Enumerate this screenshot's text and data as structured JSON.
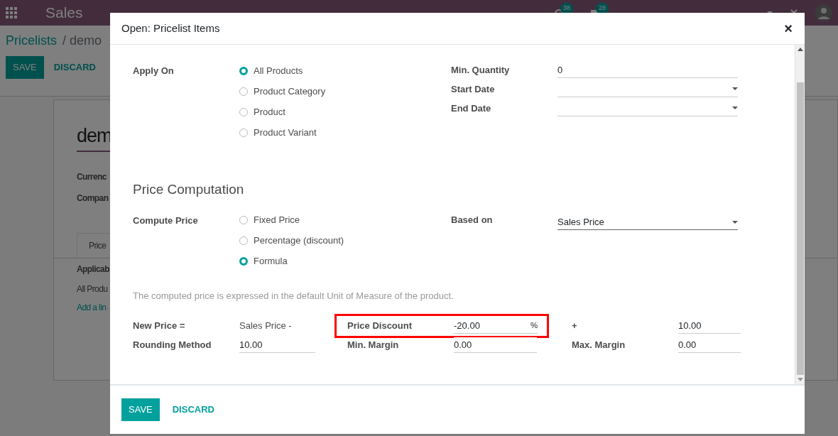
{
  "navbar": {
    "app": "Sales",
    "counters": [
      {
        "kind": "activity",
        "count": "38"
      },
      {
        "kind": "messages",
        "count": "28"
      }
    ]
  },
  "background": {
    "breadcrumb": [
      "Pricelists",
      "/ demo"
    ],
    "buttons": [
      "SAVE",
      "DISCARD"
    ],
    "title": "dem",
    "fields": [
      "Currenc",
      "Compan"
    ],
    "tab": "Price",
    "table_header": "Applicab",
    "row": "All Produ",
    "add_line": "Add a lin"
  },
  "dialog": {
    "title": "Open: Pricelist Items",
    "close": "×",
    "apply_on": {
      "label": "Apply On",
      "options": [
        {
          "label": "All Products",
          "selected": true
        },
        {
          "label": "Product Category",
          "selected": false
        },
        {
          "label": "Product",
          "selected": false
        },
        {
          "label": "Product Variant",
          "selected": false
        }
      ]
    },
    "side_fields": [
      {
        "label": "Min. Quantity",
        "kind": "text",
        "value": "0"
      },
      {
        "label": "Start Date",
        "kind": "date"
      },
      {
        "label": "End Date",
        "kind": "date"
      }
    ],
    "section_title": "Price Computation",
    "compute_price": {
      "label": "Compute Price",
      "options": [
        {
          "label": "Fixed Price",
          "selected": false
        },
        {
          "label": "Percentage (discount)",
          "selected": false
        },
        {
          "label": "Formula",
          "selected": true
        }
      ]
    },
    "based_on": {
      "label": "Based on",
      "value": "Sales Price"
    },
    "note": "The computed price is expressed in the default Unit of Measure of the product.",
    "formula": {
      "new_price_label": "New Price =",
      "base": "Sales Price -",
      "discount": {
        "label": "Price Discount",
        "value": "-20.00",
        "unit": "%",
        "highlighted": true
      },
      "surcharge": {
        "label": "+",
        "value": "10.00"
      },
      "rounding": {
        "label": "Rounding Method",
        "value": "10.00"
      },
      "min_margin": {
        "label": "Min. Margin",
        "value": "0.00"
      },
      "max_margin": {
        "label": "Max. Margin",
        "value": "0.00"
      }
    },
    "buttons": [
      {
        "label": "SAVE",
        "kind": "primary"
      },
      {
        "label": "DISCARD",
        "kind": "link"
      }
    ]
  }
}
